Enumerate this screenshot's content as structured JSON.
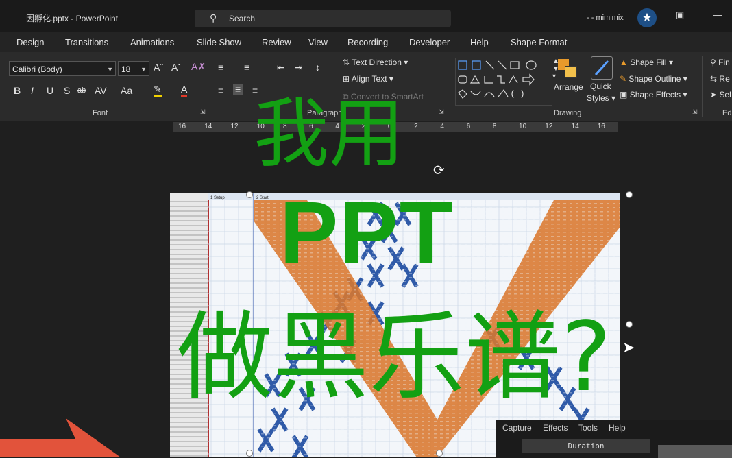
{
  "titlebar": {
    "title": "因孵化.pptx  -  PowerPoint",
    "search_placeholder": "Search",
    "user": "- - mimimix"
  },
  "tabs": [
    "Design",
    "Transitions",
    "Animations",
    "Slide Show",
    "Review",
    "View",
    "Recording",
    "Developer",
    "Help",
    "Shape Format"
  ],
  "font": {
    "family": "Calibri (Body)",
    "size": "18",
    "group_label": "Font"
  },
  "paragraph": {
    "text_direction": "Text Direction",
    "align_text": "Align Text",
    "convert": "Convert to SmartArt",
    "group_label": "Paragraph"
  },
  "drawing": {
    "arrange": "Arrange",
    "quick_styles_1": "Quick",
    "quick_styles_2": "Styles",
    "shape_fill": "Shape Fill",
    "shape_outline": "Shape Outline",
    "shape_effects": "Shape Effects",
    "group_label": "Drawing"
  },
  "editing": {
    "find": "Fin",
    "replace": "Re",
    "select": "Sel",
    "group_label": "Ed"
  },
  "ruler_ticks": [
    "16",
    "14",
    "12",
    "10",
    "8",
    "6",
    "4",
    "2",
    "0",
    "2",
    "4",
    "6",
    "8",
    "10",
    "12",
    "14",
    "16"
  ],
  "slide": {
    "section1": "1 Setup",
    "section2": "2 Start"
  },
  "overlay": {
    "line1": "我用",
    "line2": "PPT",
    "line3": "做黑乐谱?"
  },
  "capture": {
    "menu": [
      "Capture",
      "Effects",
      "Tools",
      "Help"
    ],
    "duration": "Duration"
  },
  "colors": {
    "overlay_text": "#13a013",
    "note_orange": "#d9782e",
    "note_blue": "#2f5aa8",
    "accent_arrow": "#e2533b"
  }
}
